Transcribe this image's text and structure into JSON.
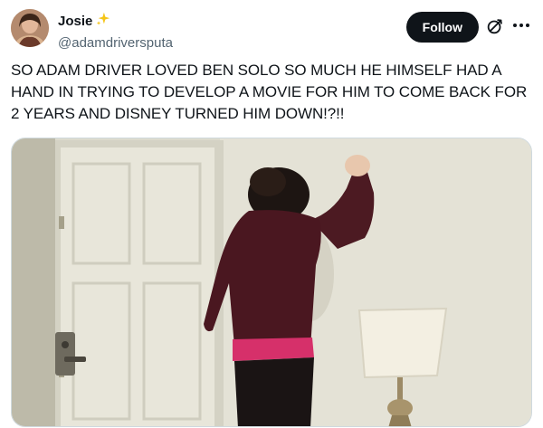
{
  "user": {
    "display_name": "Josie",
    "badge_icon": "sparkles-icon",
    "handle": "@adamdriversputa"
  },
  "actions": {
    "follow_label": "Follow",
    "grok_icon": "grok-icon",
    "more_icon": "more-icon"
  },
  "tweet": {
    "text": "SO ADAM DRIVER LOVED BEN SOLO SO MUCH HE HIMSELF HAD A HAND IN TRYING TO DEVELOP A MOVIE FOR HIM TO COME BACK FOR 2 YEARS AND DISNEY TURNED HIM DOWN!?!!"
  },
  "colors": {
    "text": "#0f1419",
    "secondary": "#536471",
    "button_bg": "#0f1419",
    "badge": "#f5c518"
  }
}
